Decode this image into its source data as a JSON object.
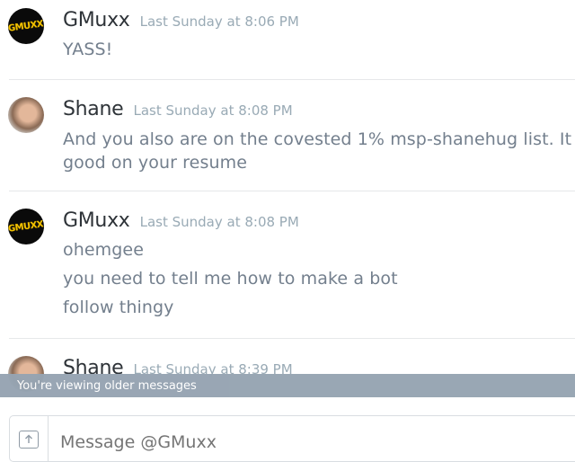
{
  "messages": [
    {
      "avatar_text": "GMUXX",
      "username": "GMuxx",
      "timestamp": "Last Sunday at 8:06 PM",
      "lines": [
        "YASS!"
      ]
    },
    {
      "avatar_text": "",
      "username": "Shane",
      "timestamp": "Last Sunday at 8:08 PM",
      "lines": [
        "And you also are on the covested 1% msp-shanehug list. It",
        "good on your resume"
      ]
    },
    {
      "avatar_text": "GMUXX",
      "username": "GMuxx",
      "timestamp": "Last Sunday at 8:08 PM",
      "lines": [
        "ohemgee",
        "you need to tell me how to make a bot",
        "follow thingy"
      ]
    },
    {
      "avatar_text": "",
      "username": "Shane",
      "timestamp": "Last Sunday at 8:39 PM",
      "lines": []
    }
  ],
  "older_messages_bar": "You're viewing older messages",
  "composer": {
    "placeholder": "Message @GMuxx",
    "upload_icon": "upload-icon"
  }
}
